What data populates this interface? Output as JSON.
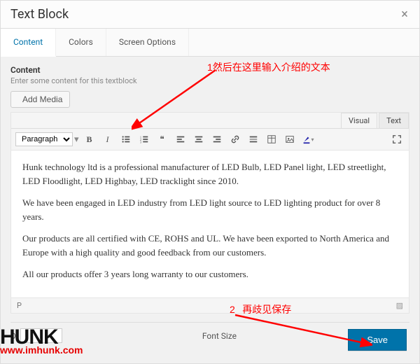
{
  "modal": {
    "title": "Text Block"
  },
  "tabs": {
    "content": "Content",
    "colors": "Colors",
    "screen_options": "Screen Options"
  },
  "section": {
    "heading": "Content",
    "sub": "Enter some content for this textblock"
  },
  "buttons": {
    "add_media": "Add Media",
    "save": "Save"
  },
  "editor": {
    "visual_tab": "Visual",
    "text_tab": "Text",
    "format_select": "Paragraph",
    "status_path": "P",
    "paragraphs": [
      "Hunk technology ltd is a professional manufacturer of LED Bulb, LED Panel light, LED streetlight, LED Floodlight, LED Highbay, LED tracklight since 2010.",
      "We have been engaged in LED industry from LED light source to LED lighting product for over 8 years.",
      "Our products are all certified with CE, ROHS and UL. We have been exported to North America and Europe with a high quality and good feedback from our customers.",
      "All our products offer 3 years long warranty to our customers.",
      "........"
    ]
  },
  "lower": {
    "font_size_label": "Font Size",
    "other_label": "D"
  },
  "annotations": {
    "text1_prefix": "1",
    "text1": "然后在这里输入介绍的文本",
    "text2_prefix": "2",
    "text2": "再歧见保存"
  },
  "brand": {
    "name": "HUNK",
    "url": "www.imhunk.com"
  }
}
